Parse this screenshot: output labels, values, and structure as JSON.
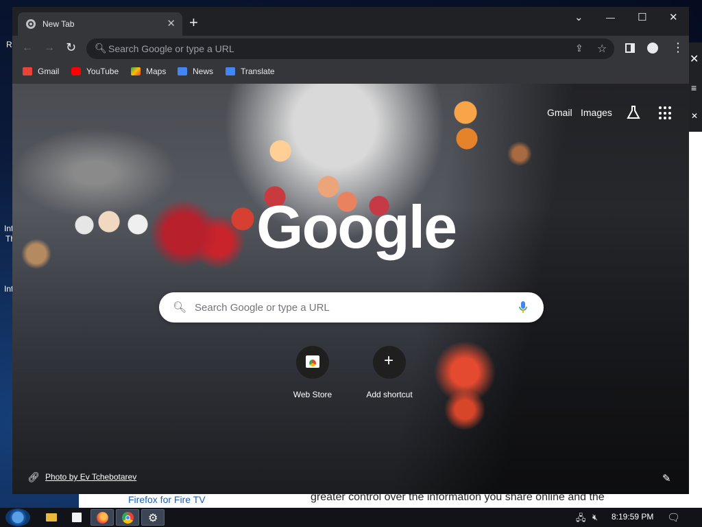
{
  "desktop": {
    "left_labels": [
      "Re",
      "Inf",
      "Th",
      "Inf"
    ]
  },
  "background_page": {
    "link_text": "Firefox for Fire TV",
    "body_text": "greater control over the information you share online and the"
  },
  "browser": {
    "tab_title": "New Tab",
    "omnibox_placeholder": "Search Google or type a URL",
    "bookmarks": [
      "Gmail",
      "YouTube",
      "Maps",
      "News",
      "Translate"
    ],
    "controls": {
      "back": "←",
      "forward": "→",
      "reload": "↻",
      "tab_close": "✕",
      "new_tab": "+",
      "dropdown": "⌄",
      "minimize": "—",
      "maximize": "☐",
      "close": "✕",
      "star": "☆",
      "share": "⇪",
      "menu": "⋮"
    }
  },
  "ntp": {
    "links": [
      "Gmail",
      "Images"
    ],
    "logo_text": "Google",
    "search_placeholder": "Search Google or type a URL",
    "shortcuts": [
      "Web Store",
      "Add shortcut"
    ],
    "photo_credit": "Photo by Ev Tchebotarev"
  },
  "taskbar": {
    "clock": "8:19:59 PM"
  },
  "colors": {
    "chrome_dark": "#202124",
    "toolbar": "#35363a",
    "taskbar": "#111318"
  }
}
